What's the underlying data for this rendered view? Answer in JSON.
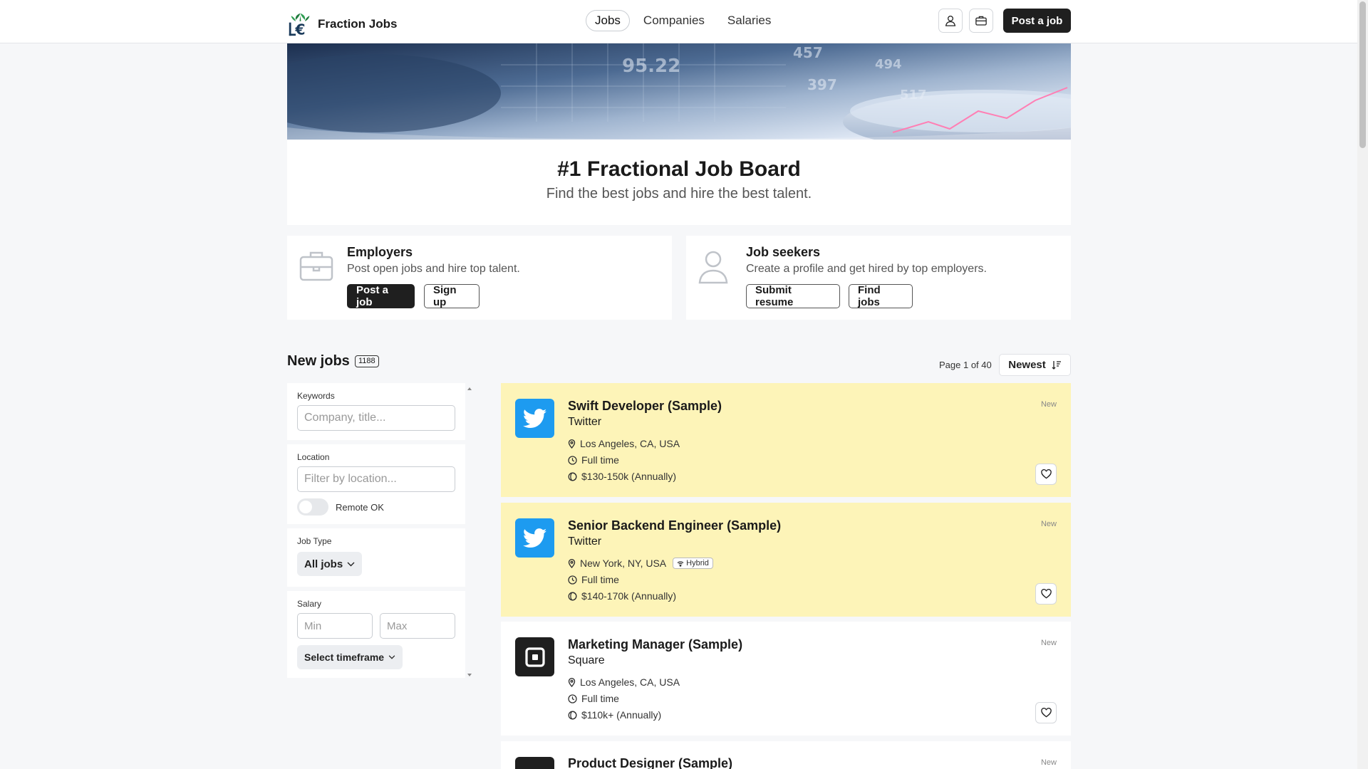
{
  "header": {
    "brand_name": "Fraction Jobs",
    "nav": [
      {
        "label": "Jobs",
        "active": true
      },
      {
        "label": "Companies",
        "active": false
      },
      {
        "label": "Salaries",
        "active": false
      }
    ],
    "post_job_label": "Post a job",
    "icons": [
      "user-icon",
      "briefcase-icon"
    ]
  },
  "hero": {
    "title": "#1 Fractional Job Board",
    "subtitle": "Find the best jobs and hire the best talent."
  },
  "employers": {
    "title": "Employers",
    "text": "Post open jobs and hire top talent.",
    "primary_label": "Post a job",
    "secondary_label": "Sign up"
  },
  "seekers": {
    "title": "Job seekers",
    "text": "Create a profile and get hired by top employers.",
    "primary_label": "Submit resume",
    "secondary_label": "Find jobs"
  },
  "jobs_header": {
    "title": "New jobs",
    "count": "1188",
    "page_info": "Page 1 of 40",
    "sort_label": "Newest"
  },
  "filters": {
    "keywords": {
      "label": "Keywords",
      "placeholder": "Company, title...",
      "value": ""
    },
    "location": {
      "label": "Location",
      "placeholder": "Filter by location...",
      "value": "",
      "remote_label": "Remote OK",
      "remote_on": false
    },
    "job_type": {
      "label": "Job Type",
      "selected": "All jobs"
    },
    "salary": {
      "label": "Salary",
      "min_placeholder": "Min",
      "max_placeholder": "Max",
      "timeframe": "Select timeframe"
    }
  },
  "jobs": [
    {
      "title": "Swift Developer (Sample)",
      "company": "Twitter",
      "location": "Los Angeles, CA, USA",
      "type": "Full time",
      "salary": "$130-150k (Annually)",
      "badge": "New",
      "featured": true,
      "logo": "twitter-logo-icon",
      "hybrid": ""
    },
    {
      "title": "Senior Backend Engineer (Sample)",
      "company": "Twitter",
      "location": "New York, NY, USA",
      "type": "Full time",
      "salary": "$140-170k (Annually)",
      "badge": "New",
      "featured": true,
      "logo": "twitter-logo-icon",
      "hybrid": "Hybrid"
    },
    {
      "title": "Marketing Manager (Sample)",
      "company": "Square",
      "location": "Los Angeles, CA, USA",
      "type": "Full time",
      "salary": "$110k+ (Annually)",
      "badge": "New",
      "featured": false,
      "logo": "square-logo-icon",
      "hybrid": ""
    },
    {
      "title": "Product Designer (Sample)",
      "company": "",
      "location": "",
      "type": "",
      "salary": "",
      "badge": "New",
      "featured": false,
      "logo": "square-logo-icon",
      "hybrid": ""
    }
  ],
  "colors": {
    "accent_dark": "#1f1f1f",
    "featured_bg": "#fdf4b8",
    "twitter_blue": "#1d9bf0",
    "brand_green": "#1e7a3c"
  }
}
